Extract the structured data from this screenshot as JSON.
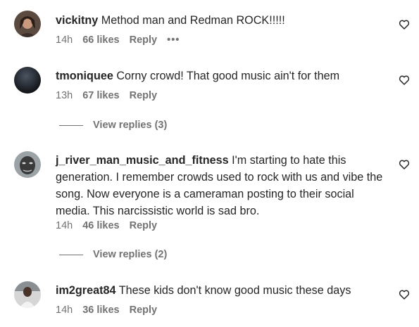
{
  "comments": [
    {
      "username": "vickitny",
      "text": "Method man and Redman ROCK!!!!!",
      "time": "14h",
      "likes": "66 likes",
      "reply": "Reply",
      "more": "•••"
    },
    {
      "username": "tmoniquee",
      "text": "Corny crowd! That good music ain't for them",
      "time": "13h",
      "likes": "67 likes",
      "reply": "Reply",
      "view_replies": "View replies (3)"
    },
    {
      "username": "j_river_man_music_and_fitness",
      "text": "I'm starting to hate this generation. I remember crowds used to rock with us and vibe the song. Now everyone is a cameraman posting to their social media. This narcissistic world is sad bro.",
      "time": "14h",
      "likes": "46 likes",
      "reply": "Reply",
      "view_replies": "View replies (2)"
    },
    {
      "username": "im2great84",
      "text": "These kids don't know good music these days",
      "time": "14h",
      "likes": "36 likes",
      "reply": "Reply"
    }
  ],
  "icons": {
    "like": "heart-outline-icon",
    "more": "more-options-icon"
  },
  "colors": {
    "text": "#262626",
    "secondary": "#737373"
  }
}
